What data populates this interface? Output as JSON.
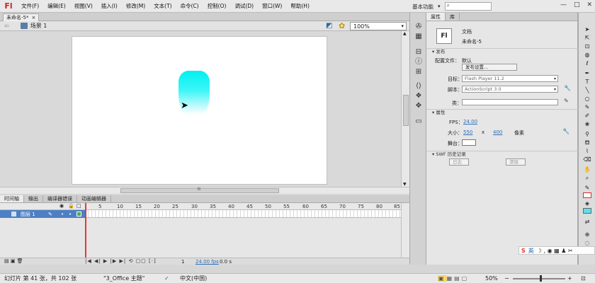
{
  "app": {
    "logo": "Fl"
  },
  "menu": [
    "文件(F)",
    "编辑(E)",
    "视图(V)",
    "插入(I)",
    "修改(M)",
    "文本(T)",
    "命令(C)",
    "控制(O)",
    "调试(D)",
    "窗口(W)",
    "帮助(H)"
  ],
  "workspace": {
    "label": "基本功能",
    "arrow": "▾"
  },
  "window_controls": [
    "—",
    "□",
    "✕"
  ],
  "doc_tab": {
    "label": "未命名-5*",
    "close": "×"
  },
  "scene": {
    "label": "场景 1",
    "zoom": "100%"
  },
  "timeline": {
    "tabs": [
      "时间轴",
      "输出",
      "编译器错误",
      "动画编辑器"
    ],
    "ticks": [
      "5",
      "10",
      "15",
      "20",
      "25",
      "30",
      "35",
      "40",
      "45",
      "50",
      "55",
      "60",
      "65",
      "70",
      "75",
      "80",
      "85"
    ],
    "layer_name": "图层 1",
    "current_frame": "1",
    "fps": "24.00 fps",
    "time": "0.0 s"
  },
  "properties": {
    "tabs": [
      "属性",
      "库"
    ],
    "doc_type": "文档",
    "doc_name": "未命名-5",
    "publish_section": "发布",
    "profile_label": "配置文件：",
    "profile_value": "默认",
    "publish_settings_btn": "发布设置...",
    "target_label": "目标：",
    "target_value": "Flash Player 11.2",
    "script_label": "脚本：",
    "script_value": "ActionScript 3.0",
    "class_label": "类：",
    "attr_section": "属性",
    "fps_label": "FPS：",
    "fps_value": "24.00",
    "size_label": "大小：",
    "width": "550",
    "times": "x",
    "height": "400",
    "unit": "像素",
    "stage_label": "舞台：",
    "swf_section": "SWF 历史记录",
    "log_btn": "日志",
    "clear_btn": "清除"
  },
  "ime": {
    "brand": "S",
    "mode": "英",
    "icons": "☽ ,  ◉ ▦ ♟ ✂"
  },
  "status": {
    "slide_info": "幻灯片 第 41 张，共 102 张",
    "theme": "\"3_Office 主题\"",
    "language": "中文(中国)",
    "zoom": "50%",
    "minus": "−",
    "plus": "+"
  },
  "colors": {
    "gradient_top": "#00f0f0",
    "fill_swatch": "#5ee0e8",
    "playhead": "#e53935",
    "layer_selected": "#4d7fc4"
  }
}
